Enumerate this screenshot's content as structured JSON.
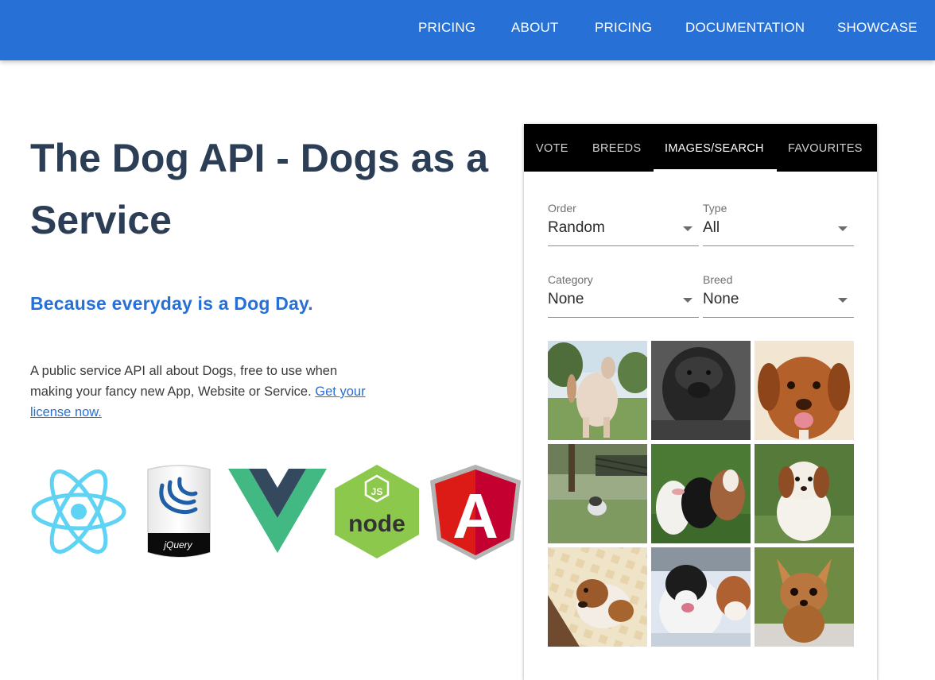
{
  "nav": {
    "items": [
      {
        "label": "PRICING"
      },
      {
        "label": "ABOUT"
      },
      {
        "label": "PRICING"
      },
      {
        "label": "DOCUMENTATION"
      },
      {
        "label": "SHOWCASE"
      }
    ]
  },
  "hero": {
    "title_bold": "The Dog API -",
    "title_rest": " Dogs as a Service",
    "tagline": "Because everyday is a Dog Day.",
    "description": "A public service API all about Dogs, free to use when making your fancy new App, Website or Service. ",
    "license_link": "Get your license now."
  },
  "logos": {
    "jquery_text": "jQuery",
    "node_text": "node",
    "node_js_badge": "JS",
    "angular_letter": "A",
    "icons": [
      "react-icon",
      "jquery-icon",
      "vue-icon",
      "nodejs-icon",
      "angular-icon"
    ]
  },
  "widget": {
    "tabs": [
      {
        "label": "VOTE"
      },
      {
        "label": "BREEDS"
      },
      {
        "label": "IMAGES/SEARCH"
      },
      {
        "label": "FAVOURITES"
      }
    ],
    "filters": {
      "order": {
        "label": "Order",
        "value": "Random"
      },
      "type": {
        "label": "Type",
        "value": "All"
      },
      "category": {
        "label": "Category",
        "value": "None"
      },
      "breed": {
        "label": "Breed",
        "value": "None"
      }
    },
    "images": [
      {
        "subject": "afghan hound on grass"
      },
      {
        "subject": "black shaggy dog"
      },
      {
        "subject": "brown retriever smiling"
      },
      {
        "subject": "small dog in backyard"
      },
      {
        "subject": "bull terriers group"
      },
      {
        "subject": "spaniel puppy on grass"
      },
      {
        "subject": "puppy lying on blanket"
      },
      {
        "subject": "saint bernard in snow"
      },
      {
        "subject": "chihuahua puppy"
      }
    ]
  },
  "colors": {
    "brand_blue": "#2670d6",
    "heading": "#2c3e55",
    "tab_bar": "#000000"
  }
}
